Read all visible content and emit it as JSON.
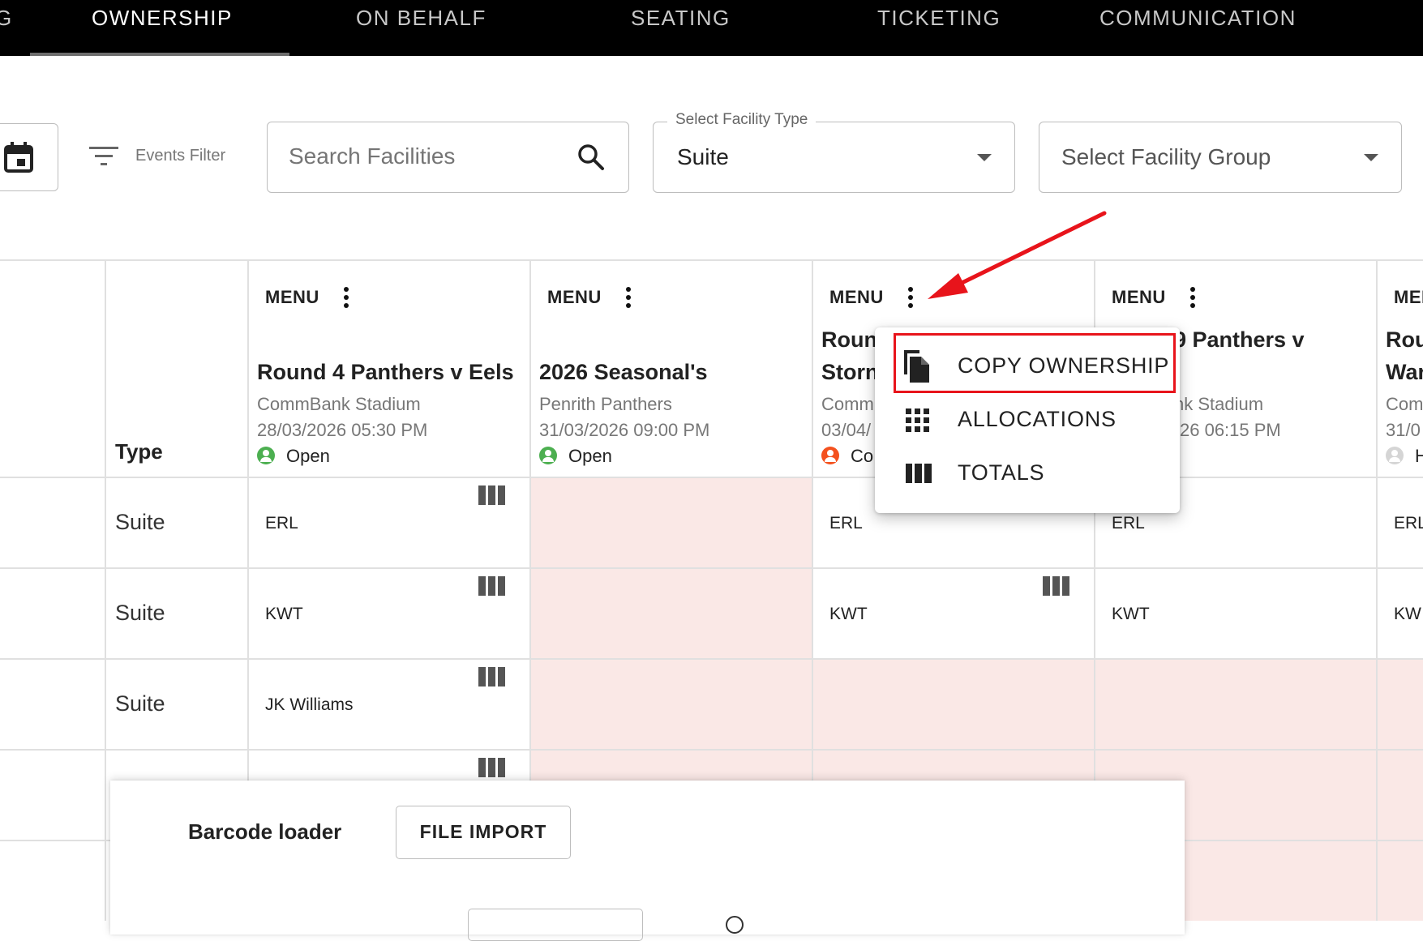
{
  "nav": {
    "tabs": [
      {
        "label": "G"
      },
      {
        "label": "OWNERSHIP"
      },
      {
        "label": "ON BEHALF"
      },
      {
        "label": "SEATING"
      },
      {
        "label": "TICKETING"
      },
      {
        "label": "COMMUNICATION"
      }
    ],
    "active_tab": "OWNERSHIP"
  },
  "filters": {
    "events_filter_label": "Events Filter",
    "search": {
      "placeholder": "Search Facilities"
    },
    "facility_type": {
      "label": "Select Facility Type",
      "value": "Suite"
    },
    "facility_group": {
      "placeholder": "Select Facility Group"
    }
  },
  "table": {
    "type_header": "Type",
    "menu_label": "MENU",
    "events": [
      {
        "title": "Round 4 Panthers v Eels",
        "venue": "CommBank Stadium",
        "datetime": "28/03/2026 05:30 PM",
        "status": "Open",
        "status_color": "#4caf50"
      },
      {
        "title": "2026 Seasonal's",
        "venue": "Penrith Panthers",
        "datetime": "31/03/2026 09:00 PM",
        "status": "Open",
        "status_color": "#4caf50"
      },
      {
        "title_line1": "Roun",
        "title_line2": "Storn",
        "venue": "Comm",
        "datetime": "03/04/",
        "status": "Co",
        "status_color": "#f4511e"
      },
      {
        "title_line1": "9 Panthers v",
        "venue": "nk Stadium",
        "datetime": "26 06:15 PM"
      },
      {
        "title_line1": "Rou",
        "title_line2": "War",
        "venue": "Com",
        "datetime": "31/0",
        "status": "H",
        "status_color": "#d5d5d5"
      }
    ],
    "rows": [
      {
        "type": "Suite",
        "cells": [
          "ERL",
          "",
          "ERL",
          "ERL",
          "ERL"
        ]
      },
      {
        "type": "Suite",
        "cells": [
          "KWT",
          "",
          "KWT",
          "KWT",
          "KW"
        ]
      },
      {
        "type": "Suite",
        "cells": [
          "JK Williams",
          "",
          "",
          "",
          ""
        ]
      }
    ]
  },
  "menu_popup": {
    "items": [
      {
        "label": "COPY OWNERSHIP",
        "icon": "copy-icon"
      },
      {
        "label": "ALLOCATIONS",
        "icon": "grid-icon"
      },
      {
        "label": "TOTALS",
        "icon": "columns-icon"
      }
    ],
    "highlight_color": "#e8141b",
    "arrow_color": "#e8141b"
  },
  "bottom_panel": {
    "barcode_label": "Barcode loader",
    "file_import_label": "FILE IMPORT"
  },
  "colors": {
    "nav_bg": "#000000",
    "unavailable_cell": "#fae8e6",
    "status_open": "#4caf50",
    "status_closed": "#f4511e"
  }
}
